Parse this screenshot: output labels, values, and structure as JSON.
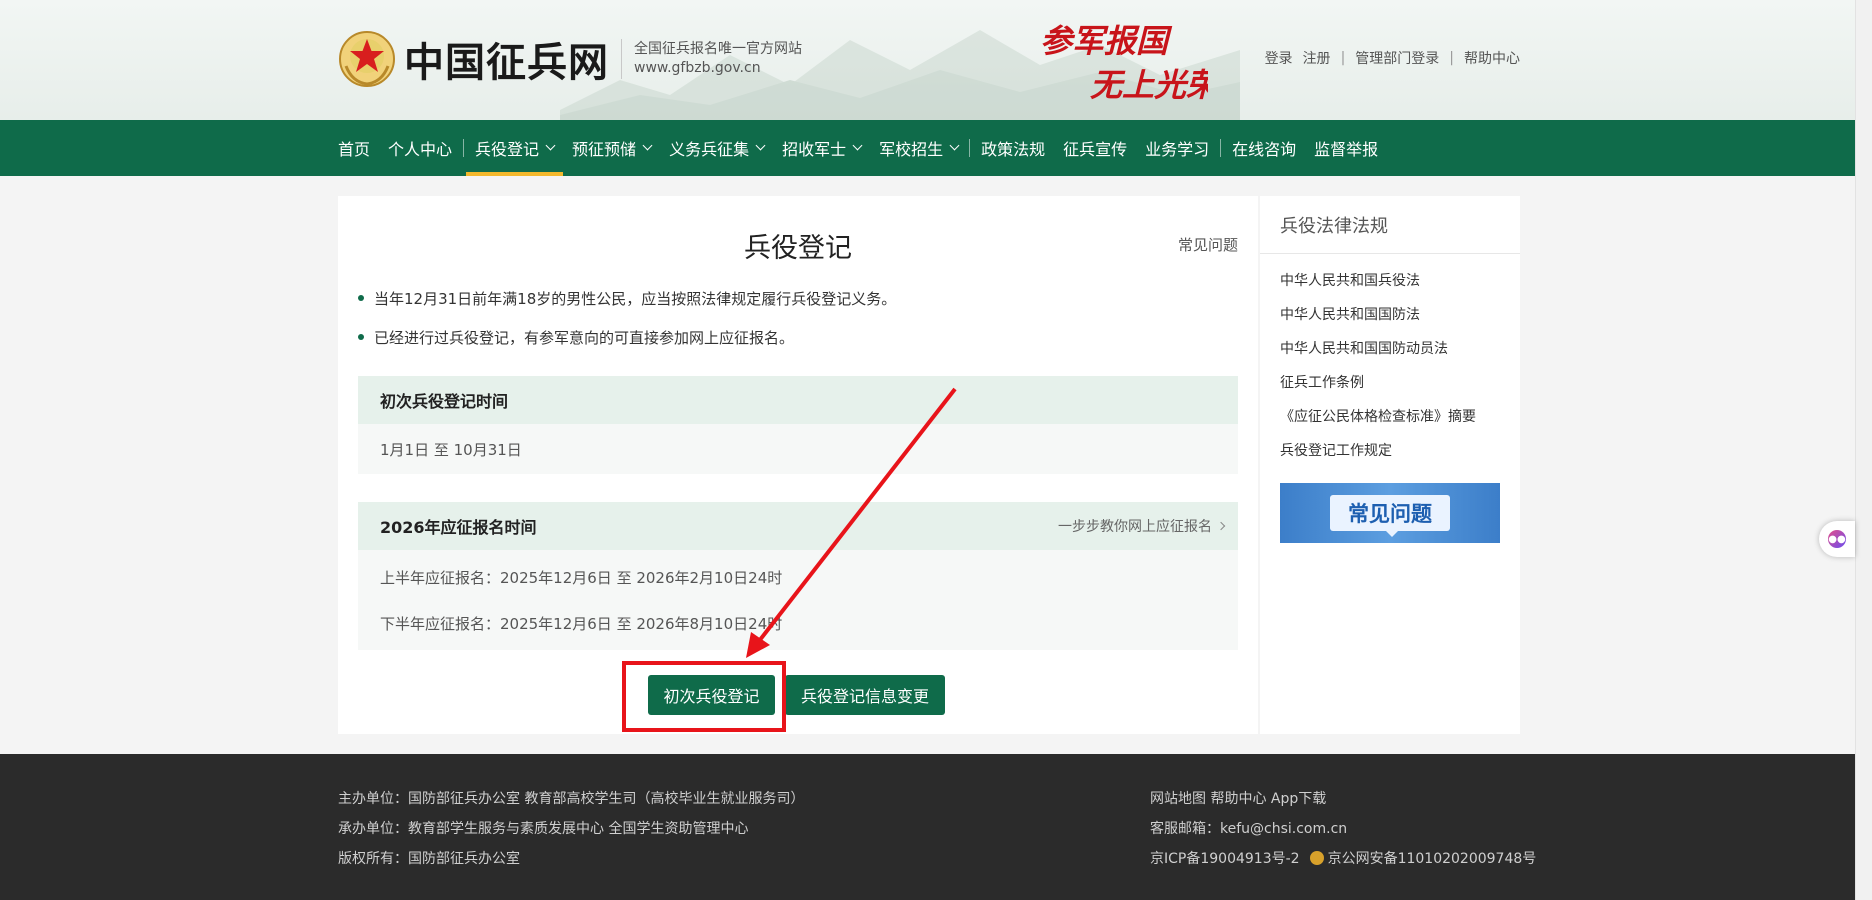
{
  "header": {
    "site_name": "中国征兵网",
    "site_tagline": "全国征兵报名唯一官方网站",
    "site_url": "www.gfbzb.gov.cn",
    "slogan_line1": "参军报国",
    "slogan_line2": "无上光荣",
    "top_links": {
      "login": "登录",
      "register": "注册",
      "admin_login": "管理部门登录",
      "help": "帮助中心"
    }
  },
  "nav": {
    "items": [
      {
        "label": "首页",
        "dropdown": false,
        "active": false
      },
      {
        "label": "个人中心",
        "dropdown": false,
        "active": false
      },
      {
        "label": "兵役登记",
        "dropdown": true,
        "active": true
      },
      {
        "label": "预征预储",
        "dropdown": true,
        "active": false
      },
      {
        "label": "义务兵征集",
        "dropdown": true,
        "active": false
      },
      {
        "label": "招收军士",
        "dropdown": true,
        "active": false
      },
      {
        "label": "军校招生",
        "dropdown": true,
        "active": false
      },
      {
        "label": "政策法规",
        "dropdown": false,
        "active": false
      },
      {
        "label": "征兵宣传",
        "dropdown": false,
        "active": false
      },
      {
        "label": "业务学习",
        "dropdown": false,
        "active": false
      },
      {
        "label": "在线咨询",
        "dropdown": false,
        "active": false
      },
      {
        "label": "监督举报",
        "dropdown": false,
        "active": false
      }
    ]
  },
  "main": {
    "title": "兵役登记",
    "faq_link": "常见问题",
    "bullets": [
      "当年12月31日前年满18岁的男性公民，应当按照法律规定履行兵役登记义务。",
      "已经进行过兵役登记，有参军意向的可直接参加网上应征报名。"
    ],
    "panel1": {
      "title": "初次兵役登记时间",
      "row": "1月1日 至 10月31日"
    },
    "panel2": {
      "title": "2026年应征报名时间",
      "link": "一步步教你网上应征报名",
      "rows": [
        "上半年应征报名：2025年12月6日 至 2026年2月10日24时",
        "下半年应征报名：2025年12月6日 至 2026年8月10日24时"
      ]
    },
    "buttons": {
      "first_register": "初次兵役登记",
      "change_info": "兵役登记信息变更"
    }
  },
  "side": {
    "title": "兵役法律法规",
    "items": [
      "中华人民共和国兵役法",
      "中华人民共和国国防法",
      "中华人民共和国国防动员法",
      "征兵工作条例",
      "《应征公民体格检查标准》摘要",
      "兵役登记工作规定"
    ],
    "banner_text": "常见问题"
  },
  "footer": {
    "left": [
      "主办单位：国防部征兵办公室   教育部高校学生司（高校毕业生就业服务司）",
      "承办单位：教育部学生服务与素质发展中心   全国学生资助管理中心",
      "版权所有：国防部征兵办公室"
    ],
    "right_links": "网站地图   帮助中心   App下载",
    "email": "客服邮箱：kefu@chsi.com.cn",
    "icp": "京ICP备19004913号-2",
    "police": "京公网安备11010202009748号"
  },
  "colors": {
    "brand_green": "#0f6b4a",
    "nav_active": "#f3b82c",
    "annotation_red": "#e8141a",
    "footer_bg": "#2b2b2b"
  }
}
